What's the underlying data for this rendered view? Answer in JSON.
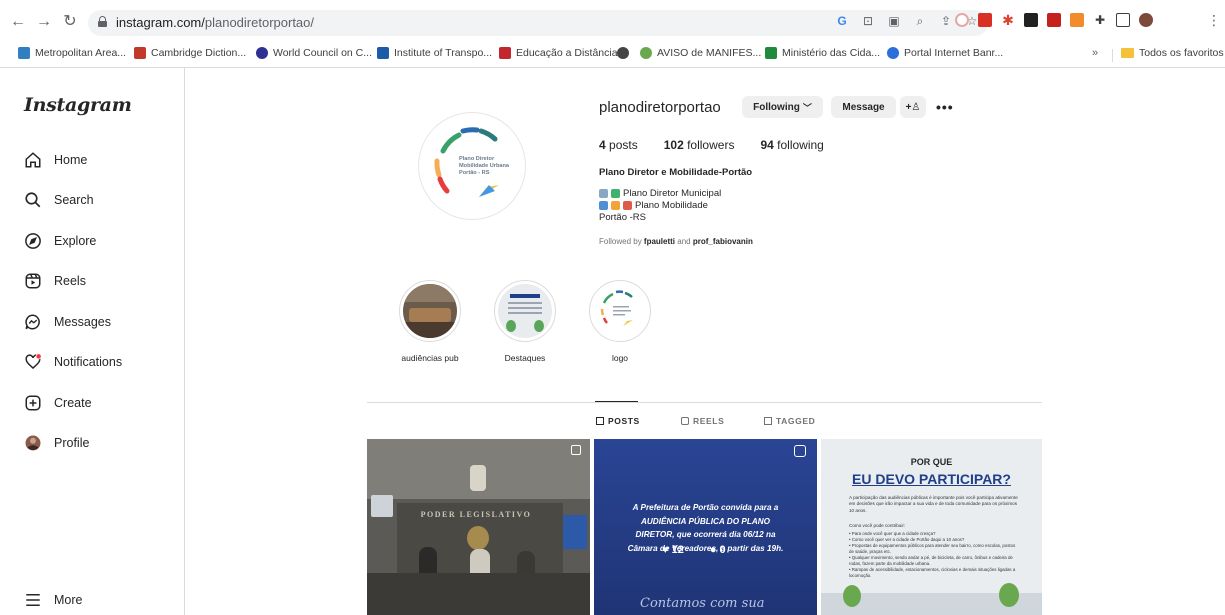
{
  "browser": {
    "url_host": "instagram.com/",
    "url_path": "planodiretorportao/",
    "bookmarks": [
      {
        "label": "Metropolitan Area...",
        "color": "#2f7fc1"
      },
      {
        "label": "Cambridge Diction...",
        "color": "#c0392b"
      },
      {
        "label": "World Council on C...",
        "color": "#2e3192"
      },
      {
        "label": "Institute of Transpo...",
        "color": "#1d5aa8"
      },
      {
        "label": "Educação a Distância",
        "color": "#c1272d"
      },
      {
        "label": "",
        "color": "#444444"
      },
      {
        "label": "AVISO de MANIFES...",
        "color": "#6aa84f"
      },
      {
        "label": "Ministério das Cida...",
        "color": "#1f8a3b"
      },
      {
        "label": "Portal Internet Banr...",
        "color": "#2a6fdb"
      }
    ],
    "bookmarks_more": "»",
    "bookmarks_folder": "Todos os favoritos"
  },
  "sidebar": {
    "logo": "Instagram",
    "items": [
      {
        "label": "Home",
        "icon": "home-icon"
      },
      {
        "label": "Search",
        "icon": "search-icon"
      },
      {
        "label": "Explore",
        "icon": "explore-icon"
      },
      {
        "label": "Reels",
        "icon": "reels-icon"
      },
      {
        "label": "Messages",
        "icon": "messages-icon"
      },
      {
        "label": "Notifications",
        "icon": "notifications-icon"
      },
      {
        "label": "Create",
        "icon": "create-icon"
      },
      {
        "label": "Profile",
        "icon": "profile-avatar"
      }
    ],
    "more": "More"
  },
  "profile": {
    "username": "planodiretorportao",
    "following_button": "Following",
    "message_button": "Message",
    "avatar_text": [
      "Plano Diretor",
      "Mobilidade Urbana",
      "Portão - RS"
    ],
    "stats": {
      "posts_count": "4",
      "posts_label": "posts",
      "followers_count": "102",
      "followers_label": "followers",
      "following_count": "94",
      "following_label": "following"
    },
    "bio_name": "Plano Diretor e Mobilidade-Portão",
    "bio_lines": [
      "Plano Diretor Municipal",
      "Plano Mobilidade",
      "Portão -RS"
    ],
    "followed_prefix": "Followed by",
    "followed_user1": "fpauletti",
    "followed_and": "and",
    "followed_user2": "prof_fabiovanin"
  },
  "highlights": [
    {
      "label": "audiências pub"
    },
    {
      "label": "Destaques"
    },
    {
      "label": "logo"
    }
  ],
  "tabs": [
    {
      "label": "POSTS",
      "active": true
    },
    {
      "label": "REELS",
      "active": false
    },
    {
      "label": "TAGGED",
      "active": false
    }
  ],
  "posts": {
    "post1": {
      "banner": "PODER LEGISLATIVO"
    },
    "post2": {
      "text": "A Prefeitura de Portão convida para a AUDIÊNCIA PÚBLICA DO PLANO DIRETOR, que ocorrerá dia 06/12 na Câmara de Vereadores, a partir das 19h.",
      "likes": "12",
      "comments": "0",
      "script_text": "Contamos com sua"
    },
    "post3": {
      "title_small": "POR QUE",
      "title_big": "EU DEVO PARTICIPAR?",
      "paragraph": "A participação das audiências públicas é importante pois você participa ativamente em decisões que irão impactar a sua vida e de toda comunidade para os próximos 10 anos.",
      "how_label": "Como você pode contribuir:",
      "bullets": [
        "Para onde você quer que a cidade cresça?",
        "Como você quer ver a cidade de Portão daqui a 10 anos?",
        "Propostas de equipamentos públicos para atender seu bairro, como escolas, postos de saúde, praças etc.",
        "Qualquer movimento, sendo andar a pé, de bicicleta, de carro, ônibus e cadeira de rodas, fazem parte da mobilidade urbana.",
        "Rampas de acessibilidade, estacionamentos, ciclovias e demais situações ligadas a locomoção."
      ]
    }
  },
  "colors": {
    "border": "#dbdbdb",
    "post2_bg": "#223a86",
    "post3_title": "#1f3f8a",
    "notification_dot": "#ff3040"
  }
}
